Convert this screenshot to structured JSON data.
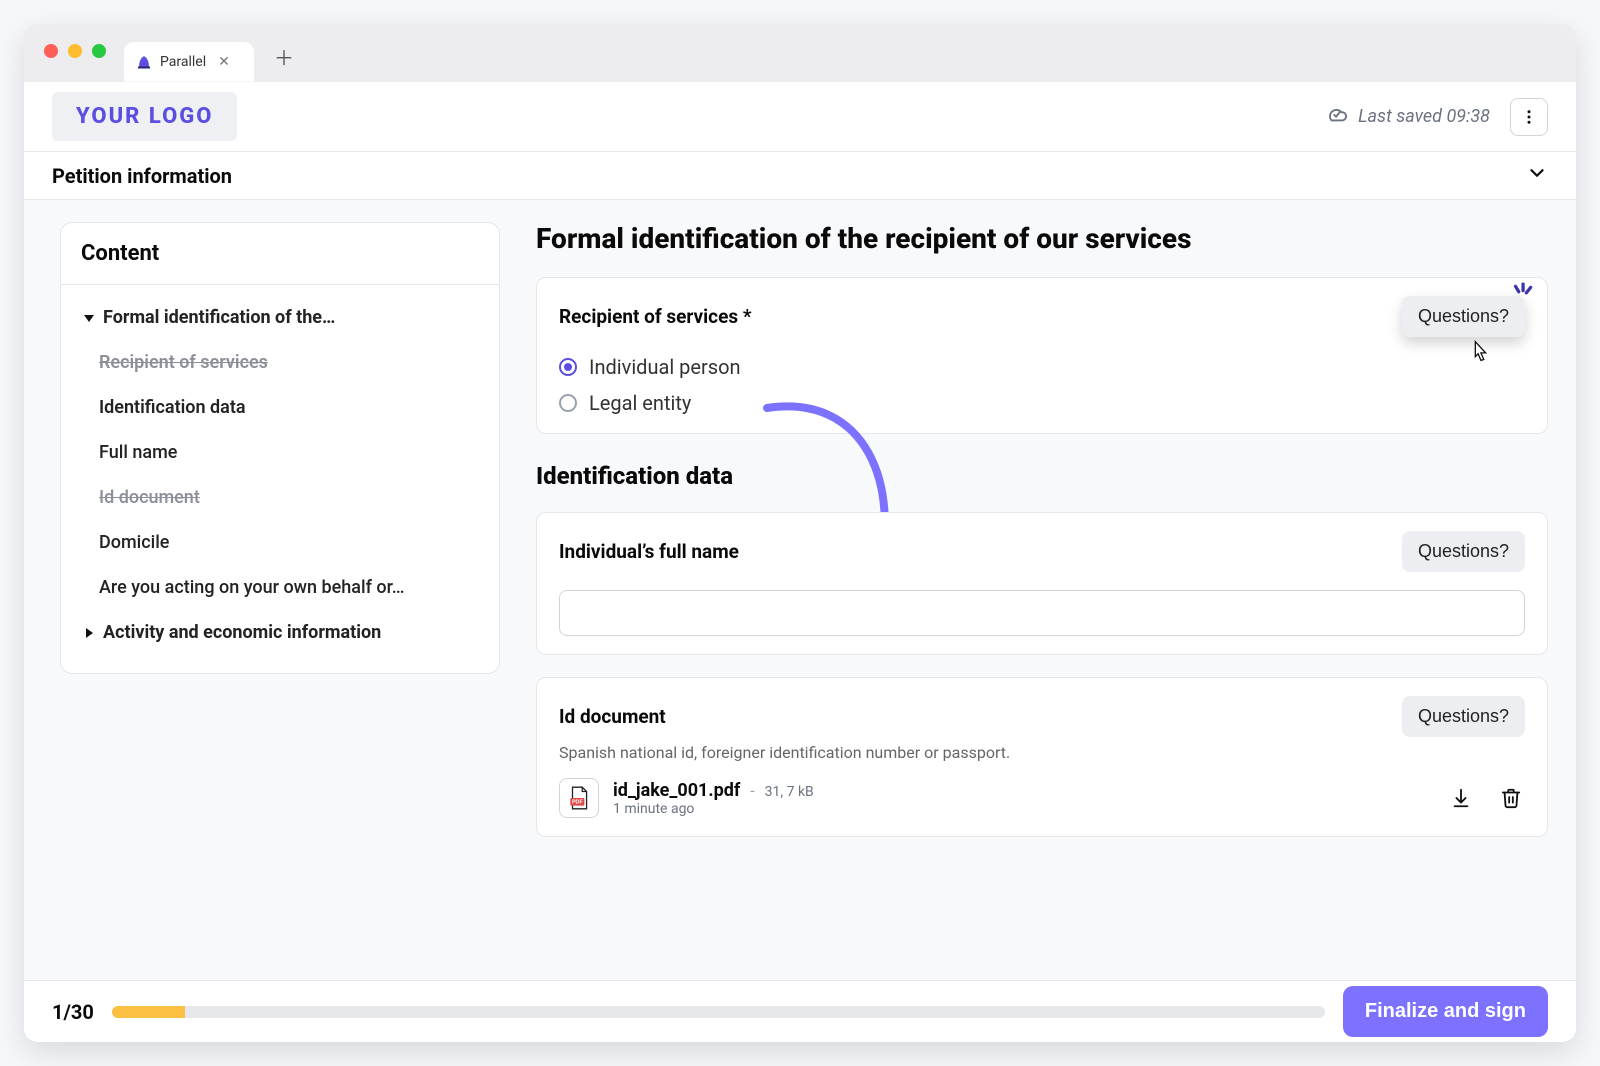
{
  "browser": {
    "tab_title": "Parallel"
  },
  "header": {
    "logo": "YOUR LOGO",
    "saved_label": "Last saved 09:38"
  },
  "petition_bar": {
    "title": "Petition information"
  },
  "toc": {
    "title": "Content",
    "items": [
      {
        "label": "Formal identification of the…"
      },
      {
        "label": "Recipient of services"
      },
      {
        "label": "Identification data"
      },
      {
        "label": "Full name"
      },
      {
        "label": "Id document"
      },
      {
        "label": "Domicile"
      },
      {
        "label": "Are you acting on your own behalf or…"
      },
      {
        "label": "Activity and economic information"
      }
    ]
  },
  "main": {
    "title": "Formal identification of the recipient of our services",
    "questions_label": "Questions?",
    "card1": {
      "label": "Recipient of services *",
      "opt_individual": "Individual person",
      "opt_legal": "Legal entity"
    },
    "id_section_title": "Identification data",
    "card2": {
      "label": "Individual’s full name",
      "placeholder": ""
    },
    "card3": {
      "label": "Id document",
      "desc": "Spanish national id, foreigner identification number or passport.",
      "file_name": "id_jake_001.pdf",
      "file_size": "31, 7 kB",
      "file_time": "1 minute ago"
    }
  },
  "footer": {
    "page": "1/30",
    "cta": "Finalize and sign"
  }
}
